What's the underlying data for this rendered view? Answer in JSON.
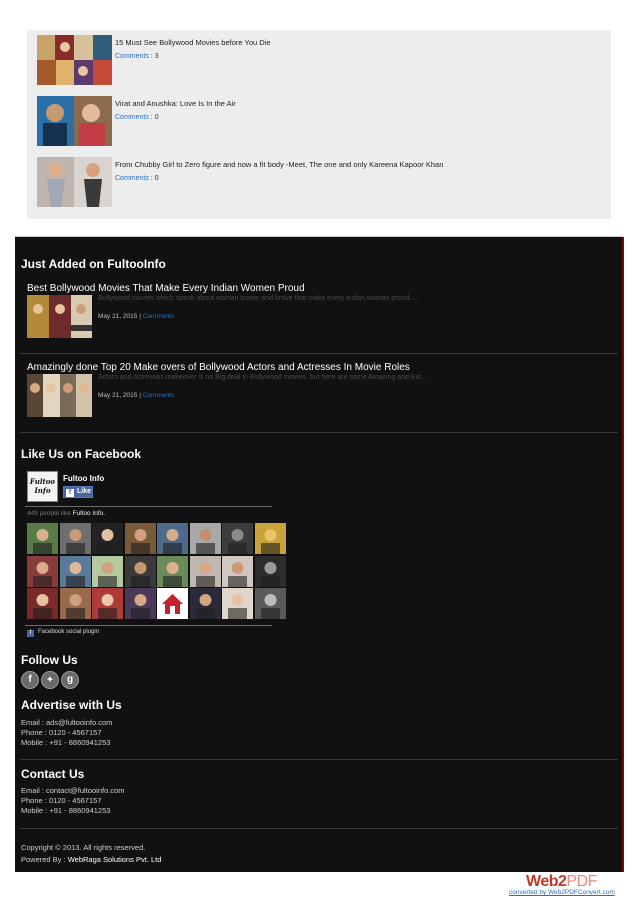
{
  "related_posts": [
    {
      "title": "15 Must See Bollywood Movies before You Die",
      "comments_label": "Comments",
      "separator": ":",
      "count": "3"
    },
    {
      "title": "Virat and Anushka: Love Is In the Air",
      "comments_label": "Comments",
      "separator": ":",
      "count": "0"
    },
    {
      "title": "From Chubby Girl to Zero figure and now a fit body -Meet, The one and only Kareena Kapoor Khan",
      "comments_label": "Comments",
      "separator": ":",
      "count": "0"
    }
  ],
  "just_added": {
    "heading": "Just Added on FultooInfo",
    "articles": [
      {
        "title": "Best Bollywood Movies That Make Every Indian Women Proud",
        "excerpt": "Bollywood movies which speak about woman power and brave that make every indian woman proud....",
        "date": "May 21, 2015",
        "pipe": "|",
        "comments": "Comments"
      },
      {
        "title": "Amazingly done Top 20 Make overs of Bollywood Actors and Actresses In Movie Roles",
        "excerpt": "Actors and Actresses makeover is no Big deal in Bollywood movies, but here are some Amazing and Ext...",
        "date": "May 21, 2015",
        "pipe": "|",
        "comments": "Comments"
      }
    ]
  },
  "facebook": {
    "heading": "Like Us on Facebook",
    "logo_text_1": "Fultoo",
    "logo_text_2": "Info",
    "page_name": "Fultoo Info",
    "like_label": "Like",
    "like_icon": "f",
    "likes_count": "449 people like",
    "likes_page": "Fultoo Info.",
    "plugin_label": "Facebook social plugin",
    "plugin_icon": "f"
  },
  "follow": {
    "heading": "Follow Us",
    "icons": [
      {
        "name": "facebook-icon",
        "glyph": "f"
      },
      {
        "name": "twitter-icon",
        "glyph": "✦"
      },
      {
        "name": "google-plus-icon",
        "glyph": "g"
      }
    ]
  },
  "advertise": {
    "heading": "Advertise with Us",
    "email": "Email : ads@fultooinfo.com",
    "phone": "Phone : 0120 - 4567157",
    "mobile": "Mobile : +91 - 8860941253"
  },
  "contact": {
    "heading": "Contact Us",
    "email": "Email : contact@fultooinfo.com",
    "phone": "Phone : 0120 - 4567157",
    "mobile": "Mobile : +91 - 8860941253"
  },
  "footer": {
    "copyright": "Copyright © 2013. All rights reserved.",
    "powered_prefix": "Powered By :",
    "powered_brand": "WebRaga Solutions Pvt. Ltd"
  },
  "stamp": {
    "logo_web": "Web2",
    "logo_pdf": "PDF",
    "text": "converted by Web2PDFConvert.com"
  },
  "colors": {
    "panel_bg": "#ededed",
    "footer_bg": "#111111",
    "link_blue": "#2a6ebb",
    "facebook_blue": "#4a66a0"
  }
}
